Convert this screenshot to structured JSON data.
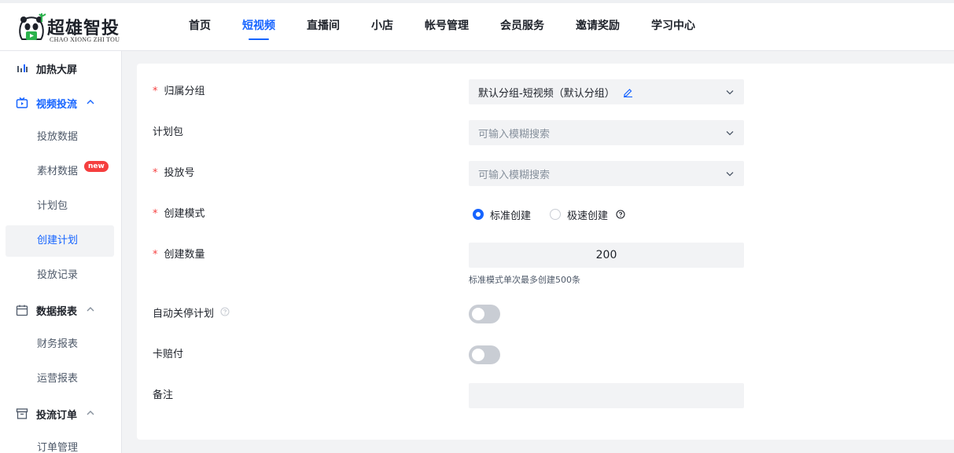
{
  "brand": {
    "name": "超雄智投",
    "subtitle": "CHAO XIONG ZHI TOU"
  },
  "nav": {
    "items": [
      {
        "label": "首页"
      },
      {
        "label": "短视频"
      },
      {
        "label": "直播间"
      },
      {
        "label": "小店"
      },
      {
        "label": "帐号管理"
      },
      {
        "label": "会员服务"
      },
      {
        "label": "邀请奖励"
      },
      {
        "label": "学习中心"
      }
    ],
    "active_index": 1
  },
  "sidebar": {
    "heat_screen": "加热大屏",
    "video_group": "视频投流",
    "video_items": [
      "投放数据",
      "素材数据",
      "计划包",
      "创建计划",
      "投放记录"
    ],
    "new_badge": "new",
    "report_group": "数据报表",
    "report_items": [
      "财务报表",
      "运营报表"
    ],
    "order_group": "投流订单",
    "order_items": [
      "订单管理"
    ],
    "selected": "创建计划"
  },
  "form": {
    "group": {
      "label": "归属分组",
      "value": "默认分组-短视频（默认分组）",
      "required": true
    },
    "plan_package": {
      "label": "计划包",
      "placeholder": "可输入模糊搜索",
      "required": false
    },
    "account": {
      "label": "投放号",
      "placeholder": "可输入模糊搜索",
      "required": true
    },
    "mode": {
      "label": "创建模式",
      "required": true,
      "options": [
        "标准创建",
        "极速创建"
      ],
      "selected": "标准创建"
    },
    "quantity": {
      "label": "创建数量",
      "value": "200",
      "hint": "标准模式单次最多创建500条",
      "required": true
    },
    "auto_pause": {
      "label": "自动关停计划",
      "enabled": false
    },
    "card_payment": {
      "label": "卡赔付",
      "enabled": false
    },
    "remark": {
      "label": "备注",
      "value": ""
    }
  },
  "colors": {
    "accent": "#1664ff",
    "required": "#f53f3f",
    "input_bg": "#f2f3f5"
  }
}
